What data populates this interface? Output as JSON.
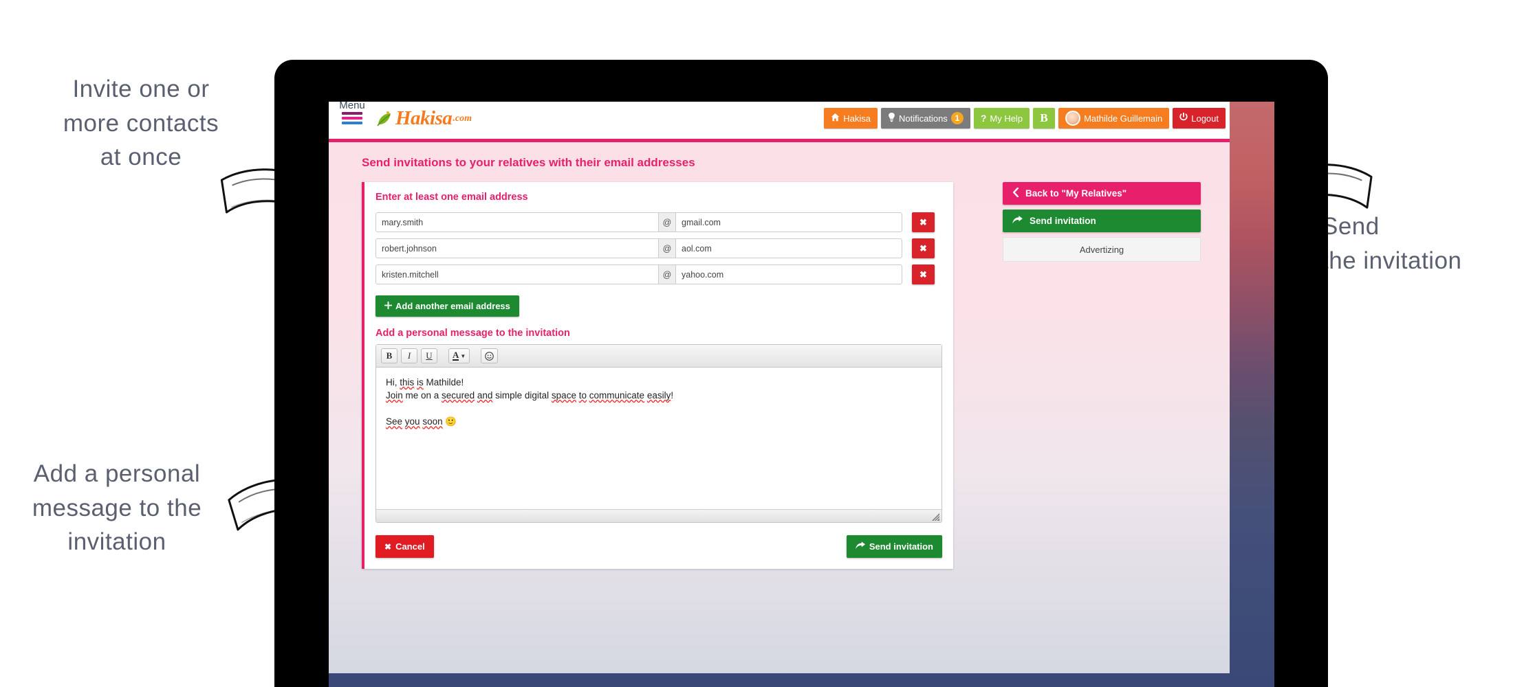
{
  "callouts": {
    "top_left": "Invite one or\nmore contacts\nat once",
    "bottom_left": "Add a personal\nmessage to the\ninvitation",
    "right": "Send\nthe invitation"
  },
  "topbar": {
    "menu_label": "Menu",
    "logo_text": "Hakisa",
    "logo_suffix": ".com",
    "nav": [
      {
        "id": "hakisa",
        "label": "Hakisa",
        "icon": "home-icon",
        "style": "orange"
      },
      {
        "id": "notifications",
        "label": "Notifications",
        "icon": "bulb-icon",
        "style": "grey",
        "badge": "1"
      },
      {
        "id": "myhelp",
        "label": "My Help",
        "icon": "question-icon",
        "style": "green"
      },
      {
        "id": "b",
        "label": "B",
        "icon": "",
        "style": "green"
      },
      {
        "id": "profile",
        "label": "Mathilde Guillemain",
        "icon": "avatar",
        "style": "orange"
      },
      {
        "id": "logout",
        "label": "Logout",
        "icon": "power-icon",
        "style": "red"
      }
    ]
  },
  "page": {
    "heading": "Send invitations to your relatives with their email addresses"
  },
  "form": {
    "section_title": "Enter at least one email address",
    "at_symbol": "@",
    "delete_label": "✖",
    "rows": [
      {
        "local": "mary.smith",
        "domain": "gmail.com"
      },
      {
        "local": "robert.johnson",
        "domain": "aol.com"
      },
      {
        "local": "kristen.mitchell",
        "domain": "yahoo.com"
      }
    ],
    "add_email_label": "Add another email address",
    "add_email_icon": "plus-icon",
    "message_title": "Add a personal message to the invitation",
    "toolbar": [
      {
        "id": "bold",
        "label": "B",
        "icon": "bold-icon"
      },
      {
        "id": "italic",
        "label": "I",
        "icon": "italic-icon"
      },
      {
        "id": "underline",
        "label": "U",
        "icon": "underline-icon"
      },
      {
        "id": "fontcolor",
        "label": "A",
        "icon": "font-color-icon"
      },
      {
        "id": "emoji",
        "label": "",
        "icon": "smiley-icon"
      }
    ],
    "message_lines": [
      {
        "parts": [
          {
            "t": "Hi, ",
            "sp": false
          },
          {
            "t": "this",
            "sp": true
          },
          {
            "t": " ",
            "sp": false
          },
          {
            "t": "is",
            "sp": true
          },
          {
            "t": " Mathilde!",
            "sp": false
          }
        ]
      },
      {
        "parts": [
          {
            "t": "Join",
            "sp": true
          },
          {
            "t": " me on a ",
            "sp": false
          },
          {
            "t": "secured",
            "sp": true
          },
          {
            "t": " ",
            "sp": false
          },
          {
            "t": "and",
            "sp": true
          },
          {
            "t": " simple digital ",
            "sp": false
          },
          {
            "t": "space",
            "sp": true
          },
          {
            "t": " ",
            "sp": false
          },
          {
            "t": "to",
            "sp": true
          },
          {
            "t": " ",
            "sp": false
          },
          {
            "t": "communicate",
            "sp": true
          },
          {
            "t": " ",
            "sp": false
          },
          {
            "t": "easily",
            "sp": true
          },
          {
            "t": "!",
            "sp": false
          }
        ]
      },
      {
        "parts": []
      },
      {
        "parts": [
          {
            "t": "See",
            "sp": true
          },
          {
            "t": " ",
            "sp": false
          },
          {
            "t": "you",
            "sp": true
          },
          {
            "t": " ",
            "sp": false
          },
          {
            "t": "soon",
            "sp": true
          },
          {
            "t": " 🙂",
            "sp": false
          }
        ]
      }
    ],
    "cancel_label": "Cancel",
    "cancel_icon": "x-icon",
    "send_label": "Send invitation",
    "send_icon": "arrow-forward-icon"
  },
  "sidebar": {
    "back_label": "Back to \"My Relatives\"",
    "back_icon": "chevron-left-icon",
    "send_label": "Send invitation",
    "send_icon": "arrow-forward-icon",
    "advert_label": "Advertizing"
  },
  "colors": {
    "pink": "#e8206c",
    "orange": "#f57c1f",
    "green": "#8dc63f",
    "dark_green": "#1d8a32",
    "red": "#d8232a",
    "grey": "#7b7b7b",
    "badge": "#f5a623",
    "callout_text": "#5b6070"
  }
}
